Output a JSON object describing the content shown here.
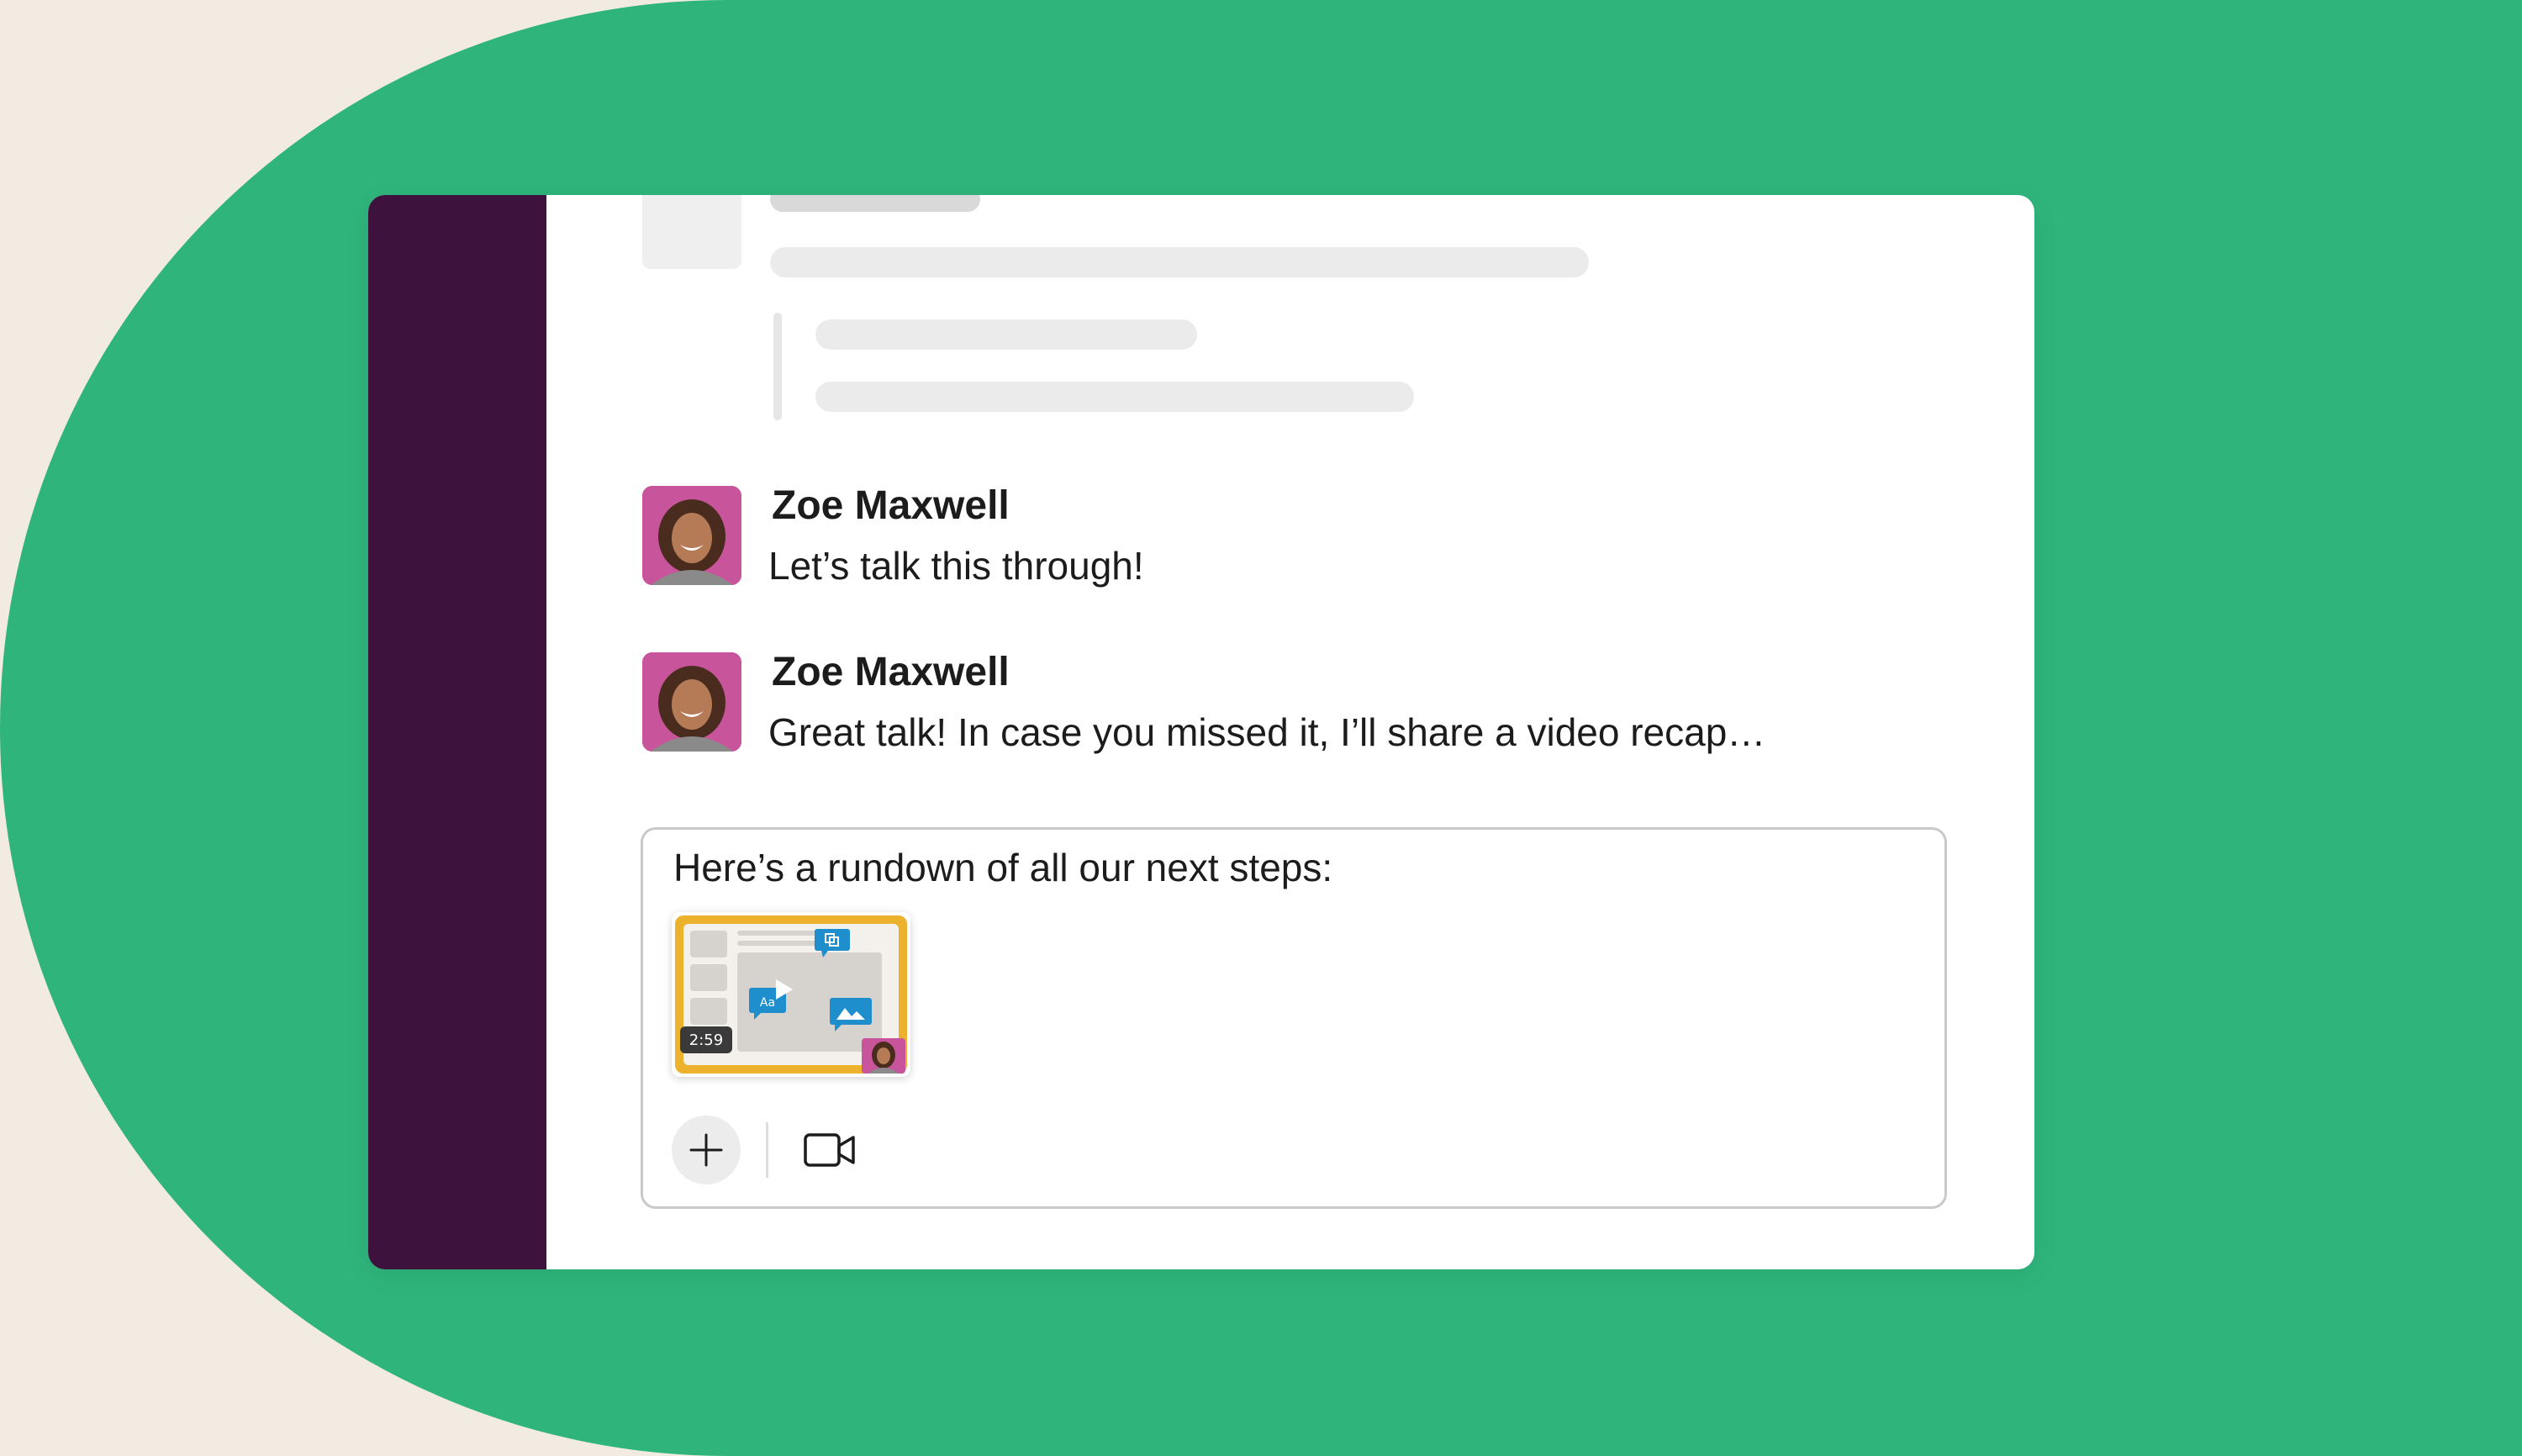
{
  "colors": {
    "background": "#f2ebe2",
    "accent_green": "#2fb57c",
    "sidebar": "#3d133e",
    "avatar_bg": "#c8559c",
    "thumbnail_frame": "#ecb22e",
    "chat_bubble_blue": "#1f8ecd"
  },
  "messages": [
    {
      "sender": "Zoe Maxwell",
      "text": "Let’s talk this through!"
    },
    {
      "sender": "Zoe Maxwell",
      "text": "Great talk! In case you missed it, I’ll share a video recap…"
    }
  ],
  "composer": {
    "text": "Here’s a rundown of all our next steps:",
    "attachment": {
      "type": "video-clip",
      "duration": "2:59"
    },
    "toolbar": {
      "add_icon": "plus-icon",
      "video_icon": "video-camera-icon"
    }
  }
}
